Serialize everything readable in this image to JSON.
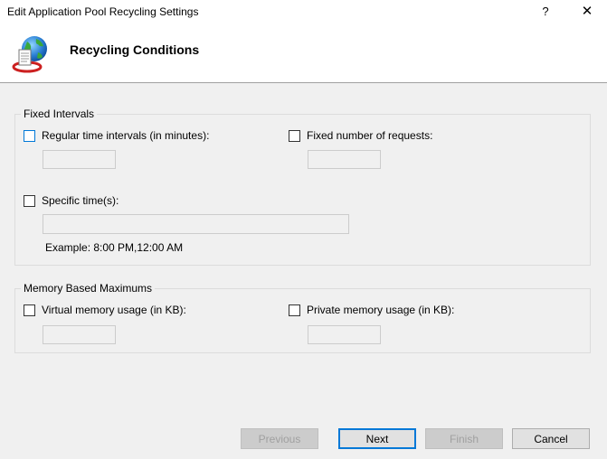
{
  "window": {
    "title": "Edit Application Pool Recycling Settings",
    "help_label": "?",
    "close_label": "✕"
  },
  "header": {
    "title": "Recycling Conditions",
    "icon": "recycling-globe-icon"
  },
  "fixed_intervals": {
    "legend": "Fixed Intervals",
    "regular_time": {
      "label": "Regular time intervals (in minutes):",
      "checked": false,
      "value": ""
    },
    "fixed_requests": {
      "label": "Fixed number of requests:",
      "checked": false,
      "value": ""
    },
    "specific_time": {
      "label": "Specific time(s):",
      "checked": false,
      "value": ""
    },
    "example": "Example: 8:00 PM,12:00 AM"
  },
  "memory": {
    "legend": "Memory Based Maximums",
    "virtual": {
      "label": "Virtual memory usage (in KB):",
      "checked": false,
      "value": ""
    },
    "private": {
      "label": "Private memory usage (in KB):",
      "checked": false,
      "value": ""
    }
  },
  "buttons": {
    "previous": "Previous",
    "next": "Next",
    "finish": "Finish",
    "cancel": "Cancel"
  },
  "colors": {
    "accent": "#0078d7",
    "background": "#f0f0f0",
    "header_background": "#ffffff"
  }
}
